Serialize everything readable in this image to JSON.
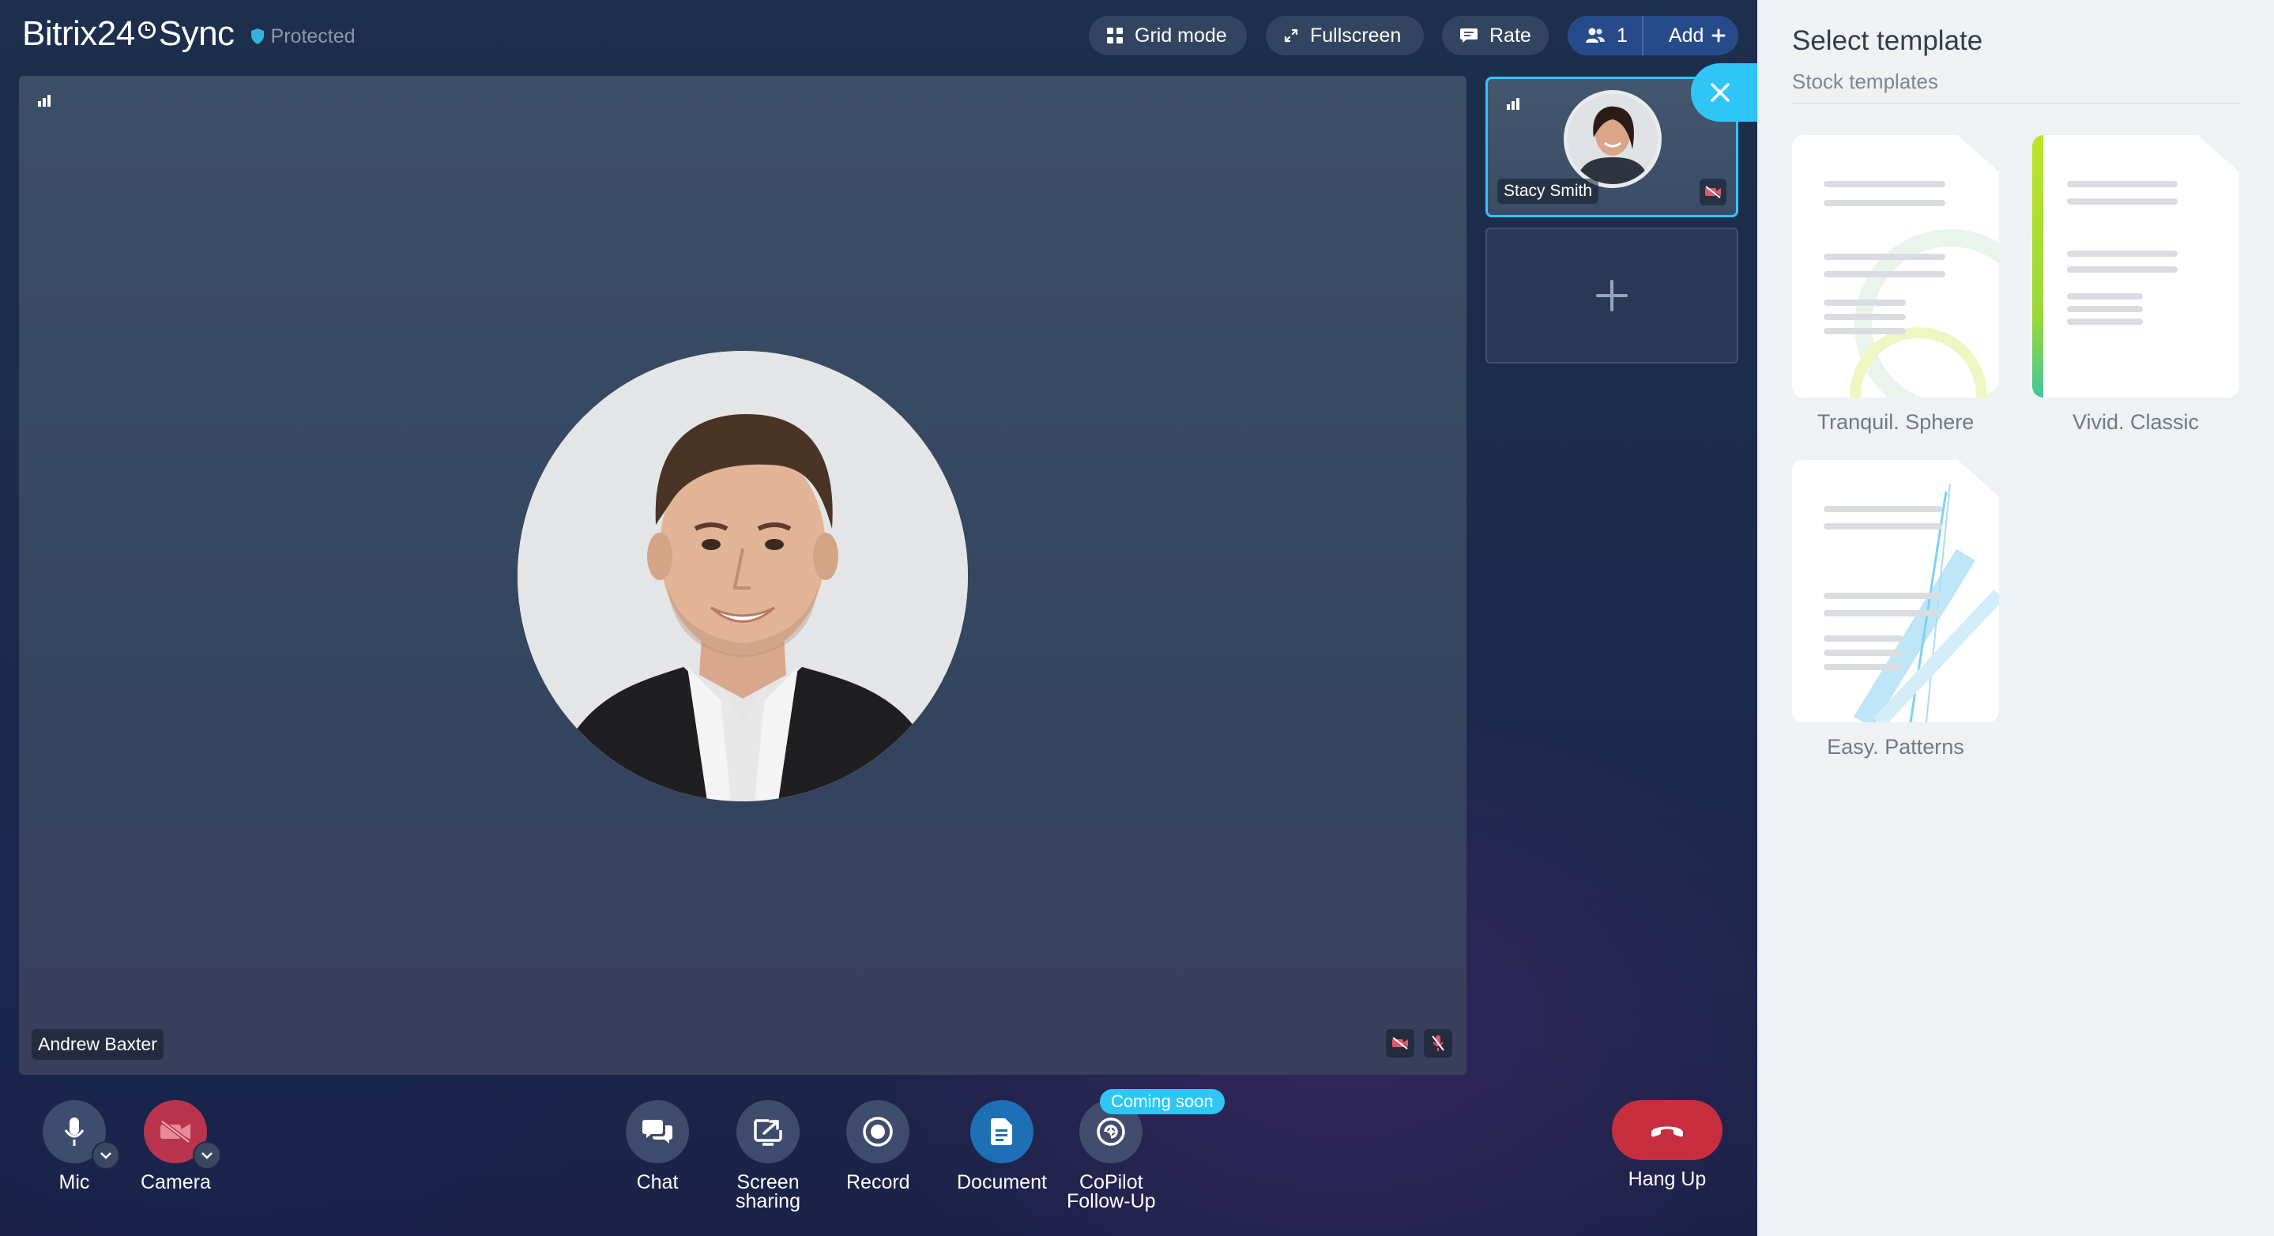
{
  "app": {
    "brand_left": "Bitrix24",
    "brand_right": "Sync",
    "protected_label": "Protected"
  },
  "toolbar": {
    "grid_mode_label": "Grid mode",
    "fullscreen_label": "Fullscreen",
    "rate_label": "Rate",
    "participants_count": "1",
    "add_label": "Add"
  },
  "main_video": {
    "participant_name": "Andrew Baxter"
  },
  "side_tiles": {
    "participant_name": "Stacy Smith"
  },
  "controls": {
    "mic_label": "Mic",
    "camera_label": "Camera",
    "chat_label": "Chat",
    "screen_sharing_label": "Screen\nsharing",
    "record_label": "Record",
    "document_label": "Document",
    "copilot_label": "CoPilot\nFollow-Up",
    "coming_soon_badge": "Coming soon",
    "hang_up_label": "Hang Up"
  },
  "template_panel": {
    "title": "Select template",
    "subtitle": "Stock templates",
    "templates": [
      {
        "name": "Tranquil. Sphere"
      },
      {
        "name": "Vivid. Classic"
      },
      {
        "name": "Easy. Patterns"
      }
    ]
  },
  "colors": {
    "accent": "#2fc6f6",
    "hang_up": "#c72f40",
    "camera_off": "#b9354e",
    "document_active": "#1e6fb5"
  }
}
